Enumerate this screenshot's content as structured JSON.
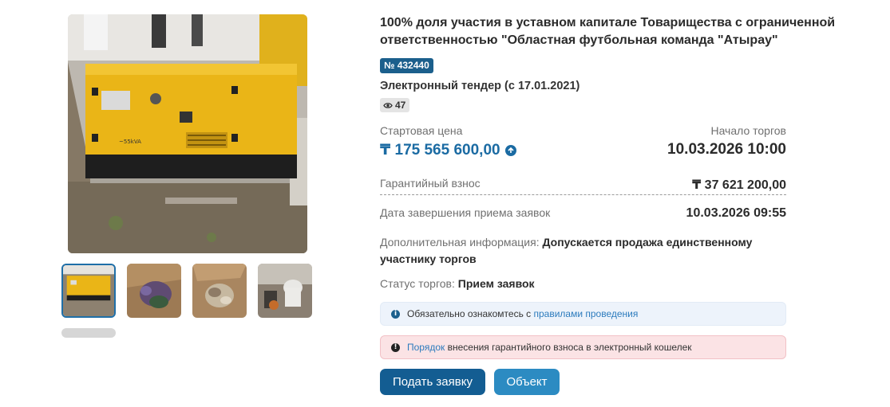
{
  "lot": {
    "title": "100% доля участия в уставном капитале Товарищества с ограниченной ответственностью \"Областная футбольная команда \"Атырау\"",
    "number": "№ 432440",
    "tender_type": "Электронный тендер (с 17.01.2021)",
    "views": "47",
    "views_icon": "eye-icon"
  },
  "gallery": {
    "main_image_label": "~55kVA",
    "thumbnail_count": 4
  },
  "pricing": {
    "start_label": "Стартовая цена",
    "start_price": "₸ 175 565 600,00",
    "start_icon": "arrow-up-circle-icon",
    "auction_label": "Начало торгов",
    "auction_date": "10.03.2026 10:00",
    "deposit_label": "Гарантийный взнос",
    "deposit_value": "₸ 37 621 200,00",
    "deadline_label": "Дата завершения приема заявок",
    "deadline_value": "10.03.2026 09:55"
  },
  "extra": {
    "label": "Дополнительная информация:",
    "value": "Допускается продажа единственному участнику торгов"
  },
  "status": {
    "label": "Статус торгов:",
    "value": "Прием заявок"
  },
  "alerts": {
    "info_text": "Обязательно ознакомтесь с ",
    "info_link": "правилами проведения",
    "danger_link": "Порядок",
    "danger_text": " внесения гарантийного взноса в электронный кошелек"
  },
  "buttons": {
    "apply": "Подать заявку",
    "object": "Объект"
  },
  "colors": {
    "accent": "#1b6ba3",
    "badge": "#1b5f8c",
    "button_primary": "#135d92",
    "button_secondary": "#2c8bc2",
    "info_bg": "#edf3fb",
    "danger_bg": "#fbe3e5"
  }
}
